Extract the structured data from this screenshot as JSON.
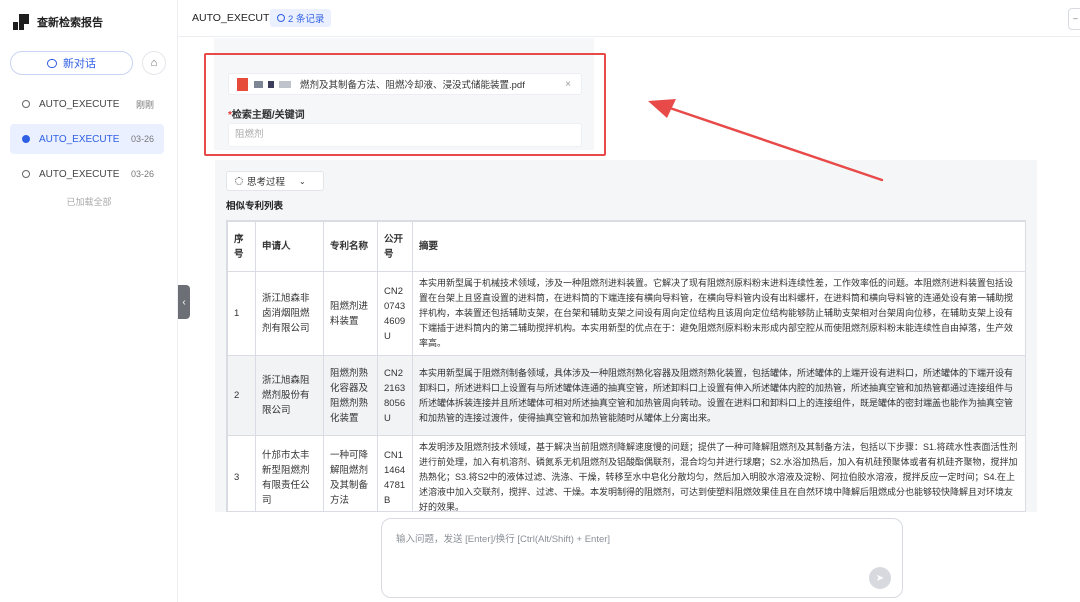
{
  "app": {
    "name": "查新检索报告"
  },
  "sidebar": {
    "new_chat": "新对话",
    "items": [
      {
        "title": "AUTO_EXECUTE",
        "time": "刚刚"
      },
      {
        "title": "AUTO_EXECUTE",
        "time": "03-26"
      },
      {
        "title": "AUTO_EXECUTE",
        "time": "03-26"
      }
    ],
    "loaded_all": "已加载全部"
  },
  "header": {
    "title": "AUTO_EXECUTE",
    "records": "2 条记录"
  },
  "form": {
    "file_name": "燃剂及其制备方法、阻燃冷却液、浸没式储能装置.pdf",
    "file_remove": "×",
    "keyword_required": "*",
    "keyword_label": "检索主题/关键词",
    "keyword_value": "阻燃剂"
  },
  "thinking": {
    "label": "思考过程"
  },
  "patents": {
    "title": "相似专利列表",
    "columns": [
      "序号",
      "申请人",
      "专利名称",
      "公开号",
      "摘要"
    ],
    "rows": [
      {
        "no": "1",
        "applicant": "浙江旭森非卤消烟阻燃剂有限公司",
        "name": "阻燃剂进料装置",
        "pub": "CN207434609U",
        "abstract": "本实用新型属于机械技术领域，涉及一种阻燃剂进料装置。它解决了现有阻燃剂原料粉末进料连续性差，工作效率低的问题。本阻燃剂进料装置包括设置在台架上且竖直设置的进料筒，在进料筒的下端连接有横向导料管，在横向导料管内设有出料螺杆，在进料筒和横向导料管的连通处设有第一辅助搅拌机构，本装置还包括辅助支架，在台架和辅助支架之间设有周向定位结构且该周向定位结构能够防止辅助支架相对台架周向位移，在辅助支架上设有下端插于进料筒内的第二辅助搅拌机构。本实用新型的优点在于：避免阻燃剂原料粉末形成内部空腔从而使阻燃剂原料粉末能连续性自由掉落，生产效率高。"
      },
      {
        "no": "2",
        "applicant": "浙江旭森阻燃剂股份有限公司",
        "name": "阻燃剂熟化容器及阻燃剂熟化装置",
        "pub": "CN221638056U",
        "abstract": "本实用新型属于阻燃剂制备领域，具体涉及一种阻燃剂熟化容器及阻燃剂熟化装置，包括罐体，所述罐体的上端开设有进料口，所述罐体的下端开设有卸料口，所述进料口上设置有与所述罐体连通的抽真空管，所述卸料口上设置有伸入所述罐体内腔的加热管，所述抽真空管和加热管都通过连接组件与所述罐体拆装连接并且所述罐体可相对所述抽真空管和加热管周向转动。设置在进料口和卸料口上的连接组件，既是罐体的密封端盖也能作为抽真空管和加热管的连接过渡件，使得抽真空管和加热管能随时从罐体上分离出来。"
      },
      {
        "no": "3",
        "applicant": "什邡市太丰新型阻燃剂有限责任公司",
        "name": "一种可降解阻燃剂及其制备方法",
        "pub": "CN114644781B",
        "abstract": "本发明涉及阻燃剂技术领域，基于解决当前阻燃剂降解速度慢的问题；提供了一种可降解阻燃剂及其制备方法，包括以下步骤：S1.将疏水性表面活性剂进行前处理，加入有机溶剂、磷氮系无机阻燃剂及铝酸酯偶联剂，混合均匀并进行球磨；S2.水浴加热后，加入有机硅预聚体或者有机硅齐聚物，搅拌加热熟化；S3.将S2中的液体过滤、洗涤、干燥，转移至水中皂化分散均匀，然后加入明胶水溶液及淀粉、阿拉伯胶水溶液，搅拌反应一定时间；S4.在上述溶液中加入交联剂，搅拌、过滤、干燥。本发明制得的阻燃剂，可达到使塑料阻燃效果佳且在自然环境中降解后阻燃成分也能够较快降解且对环境友好的效果。"
      }
    ]
  },
  "composer": {
    "placeholder": "输入问题，发送 [Enter]/换行 [Ctrl(Alt/Shift) + Enter]"
  },
  "colors": {
    "accent": "#2f5fe3",
    "highlight": "#e84a4a"
  }
}
